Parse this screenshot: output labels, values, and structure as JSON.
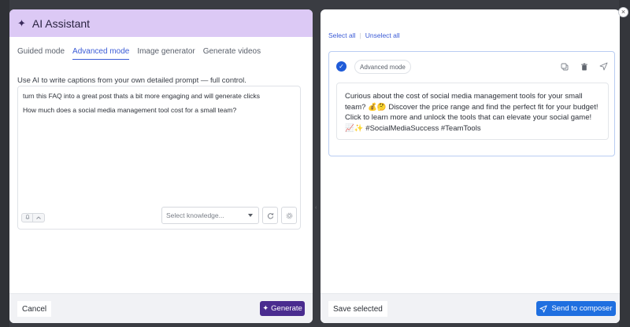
{
  "colors": {
    "header_bg": "#dcc9f5",
    "primary_purple": "#4a2c8f",
    "primary_blue": "#1f6fe0",
    "link_blue": "#3b5bd6",
    "backdrop": "#3a3c42"
  },
  "left": {
    "header": {
      "icon": "sparkle-icon",
      "title": "AI Assistant"
    },
    "tabs": [
      {
        "label": "Guided mode",
        "active": false
      },
      {
        "label": "Advanced mode",
        "active": true
      },
      {
        "label": "Image generator",
        "active": false
      },
      {
        "label": "Generate videos",
        "active": false
      }
    ],
    "description": "Use AI to write captions from your own detailed prompt — full control.",
    "prompt": {
      "line1": "turn this FAQ into a great post thats a bit more engaging and will generate clicks",
      "line2": "How much does a social media management tool cost for a small team?"
    },
    "knowledge_select": {
      "placeholder": "Select knowledge..."
    },
    "footer": {
      "cancel_label": "Cancel",
      "generate_label": "Generate"
    }
  },
  "right": {
    "select_all": "Select all",
    "unselect_all": "Unselect all",
    "card": {
      "selected": true,
      "mode_badge": "Advanced mode",
      "post_text": "Curious about the cost of social media management tools for your small team? 💰🤔 Discover the price range and find the perfect fit for your budget! Click to learn more and unlock the tools that can elevate your social game! 📈✨ #SocialMediaSuccess #TeamTools"
    },
    "footer": {
      "save_label": "Save selected",
      "send_label": "Send to composer"
    }
  }
}
